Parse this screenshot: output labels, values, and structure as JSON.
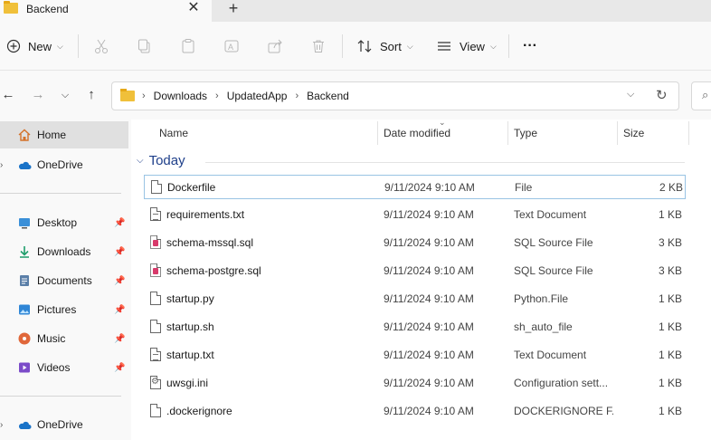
{
  "window": {
    "tab_title": "Backend"
  },
  "toolbar": {
    "new_label": "New",
    "sort_label": "Sort",
    "view_label": "View",
    "more_label": "···"
  },
  "address": {
    "crumbs": [
      "Downloads",
      "UpdatedApp",
      "Backend"
    ]
  },
  "sidebar": {
    "home": "Home",
    "onedrive": "OneDrive",
    "desktop": "Desktop",
    "downloads": "Downloads",
    "documents": "Documents",
    "pictures": "Pictures",
    "music": "Music",
    "videos": "Videos",
    "onedrive2": "OneDrive"
  },
  "columns": {
    "name": "Name",
    "date": "Date modified",
    "type": "Type",
    "size": "Size"
  },
  "group_label": "Today",
  "files": [
    {
      "name": "Dockerfile",
      "date": "9/11/2024 9:10 AM",
      "type": "File",
      "size": "2 KB",
      "icon": "blank-file-icon"
    },
    {
      "name": "requirements.txt",
      "date": "9/11/2024 9:10 AM",
      "type": "Text Document",
      "size": "1 KB",
      "icon": "text-file-icon"
    },
    {
      "name": "schema-mssql.sql",
      "date": "9/11/2024 9:10 AM",
      "type": "SQL Source File",
      "size": "3 KB",
      "icon": "sql-file-icon"
    },
    {
      "name": "schema-postgre.sql",
      "date": "9/11/2024 9:10 AM",
      "type": "SQL Source File",
      "size": "3 KB",
      "icon": "sql-file-icon"
    },
    {
      "name": "startup.py",
      "date": "9/11/2024 9:10 AM",
      "type": "Python.File",
      "size": "1 KB",
      "icon": "blank-file-icon"
    },
    {
      "name": "startup.sh",
      "date": "9/11/2024 9:10 AM",
      "type": "sh_auto_file",
      "size": "1 KB",
      "icon": "blank-file-icon"
    },
    {
      "name": "startup.txt",
      "date": "9/11/2024 9:10 AM",
      "type": "Text Document",
      "size": "1 KB",
      "icon": "text-file-icon"
    },
    {
      "name": "uwsgi.ini",
      "date": "9/11/2024 9:10 AM",
      "type": "Configuration sett...",
      "size": "1 KB",
      "icon": "config-file-icon"
    },
    {
      "name": ".dockerignore",
      "date": "9/11/2024 9:10 AM",
      "type": "DOCKERIGNORE F...",
      "size": "1 KB",
      "icon": "blank-file-icon"
    }
  ],
  "colors": {
    "accent": "#1e3f8a",
    "selection_border": "#99c4e4",
    "folder": "#f0c03a"
  }
}
